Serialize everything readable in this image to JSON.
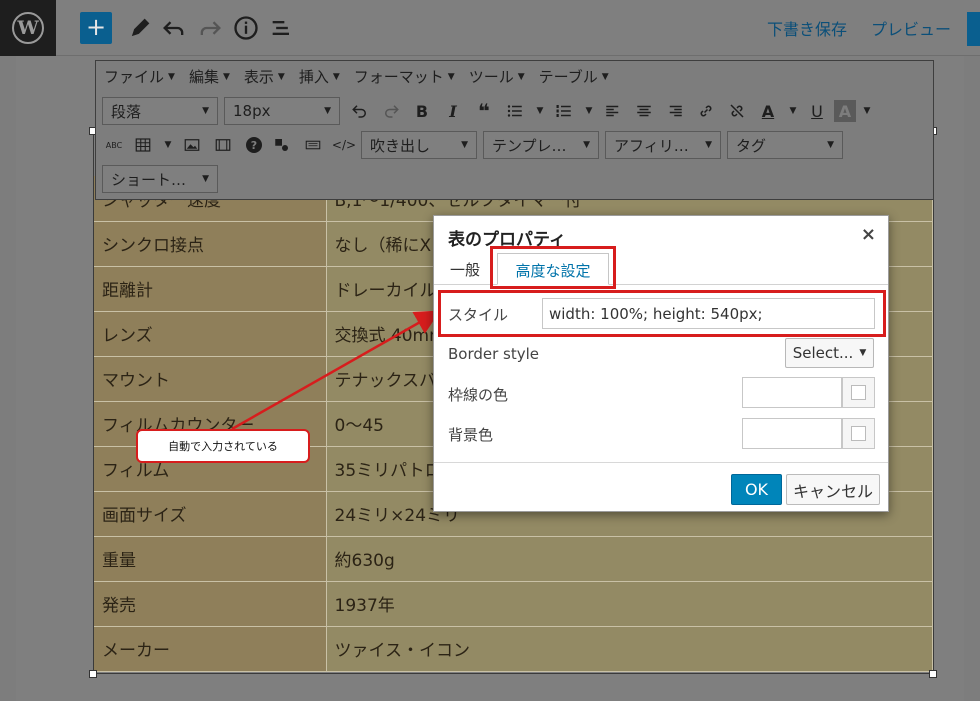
{
  "topbar": {
    "save_draft": "下書き保存",
    "preview": "プレビュー"
  },
  "menubar": [
    {
      "label": "ファイル"
    },
    {
      "label": "編集"
    },
    {
      "label": "表示"
    },
    {
      "label": "挿入"
    },
    {
      "label": "フォーマット"
    },
    {
      "label": "ツール"
    },
    {
      "label": "テーブル"
    }
  ],
  "toolbar": {
    "format_select": "段落",
    "size_select": "18px",
    "bold": "B",
    "italic": "I",
    "quote": "❝",
    "underline": "U",
    "text_color": "A",
    "bg_color": "A",
    "abc": "ABC",
    "help": "?",
    "code": "</>",
    "fukidashi": "吹き出し",
    "template": "テンプレ…",
    "affiliate": "アフィリ…",
    "tag": "タグ",
    "shortcode": "ショート…"
  },
  "table": {
    "rows": [
      {
        "key": "シャッター速度",
        "value": "B,1〜1/400、セルフタイマー付"
      },
      {
        "key": "シンクロ接点",
        "value": "なし（稀にX"
      },
      {
        "key": "距離計",
        "value": "ドレーカイル"
      },
      {
        "key": "レンズ",
        "value": "交換式 40mm"
      },
      {
        "key": "マウント",
        "value": "テナックスバ"
      },
      {
        "key": "フィルムカウンター",
        "value": "0〜45"
      },
      {
        "key": "フィルム",
        "value": "35ミリパトロ"
      },
      {
        "key": "画面サイズ",
        "value": "24ミリ×24ミリ"
      },
      {
        "key": "重量",
        "value": "約630g"
      },
      {
        "key": "発売",
        "value": "1937年"
      },
      {
        "key": "メーカー",
        "value": "ツァイス・イコン"
      }
    ]
  },
  "callout": {
    "text": "自動で入力されている"
  },
  "modal": {
    "title": "表のプロパティ",
    "close": "×",
    "tabs": {
      "general": "一般",
      "advanced": "高度な設定"
    },
    "style_label": "スタイル",
    "style_value": "width: 100%; height: 540px;",
    "border_style_label": "Border style",
    "border_style_select": "Select...",
    "border_color_label": "枠線の色",
    "bg_color_label": "背景色",
    "ok": "OK",
    "cancel": "キャンセル"
  },
  "colors": {
    "accent": "#0085ba",
    "annotation_red": "#d71d1d",
    "link": "#0073aa"
  },
  "icons": [
    "wordpress-logo-icon",
    "plus-icon",
    "pen-icon",
    "undo-icon",
    "redo-icon",
    "info-icon",
    "list-view-icon"
  ]
}
